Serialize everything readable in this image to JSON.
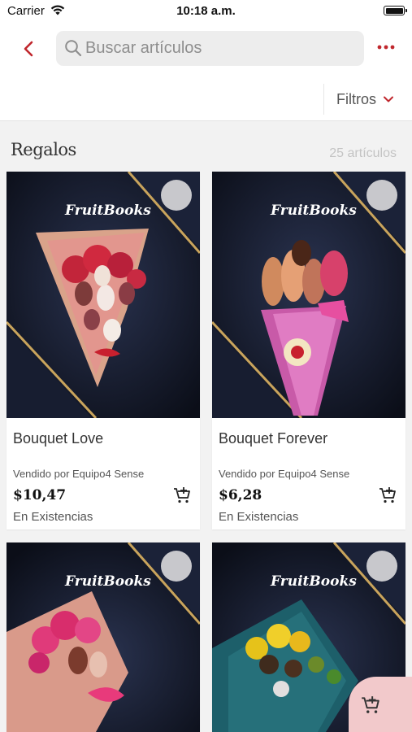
{
  "status_bar": {
    "carrier": "Carrier",
    "time": "10:18 a.m."
  },
  "header": {
    "search_placeholder": "Buscar artículos",
    "filters_label": "Filtros"
  },
  "section": {
    "title": "Regalos",
    "item_count": "25 artículos"
  },
  "products": [
    {
      "name": "Bouquet Love",
      "seller": "Vendido por Equipo4 Sense",
      "price": "$10,47",
      "stock": "En Existencias",
      "brand": "FruitBooks"
    },
    {
      "name": "Bouquet Forever",
      "seller": "Vendido por Equipo4 Sense",
      "price": "$6,28",
      "stock": "En Existencias",
      "brand": "FruitBooks"
    },
    {
      "name": "",
      "seller": "",
      "price": "",
      "stock": "",
      "brand": "FruitBooks"
    },
    {
      "name": "",
      "seller": "",
      "price": "",
      "stock": "",
      "brand": "FruitBooks"
    }
  ],
  "colors": {
    "accent": "#c0272d",
    "fab_bg": "#f2c9cb",
    "photo_bg": "#10141f",
    "gold_stripe": "#c9a45c"
  },
  "icons": [
    "back-icon",
    "search-icon",
    "more-icon",
    "chevron-down-icon",
    "favorite-icon",
    "add-to-cart-icon"
  ]
}
